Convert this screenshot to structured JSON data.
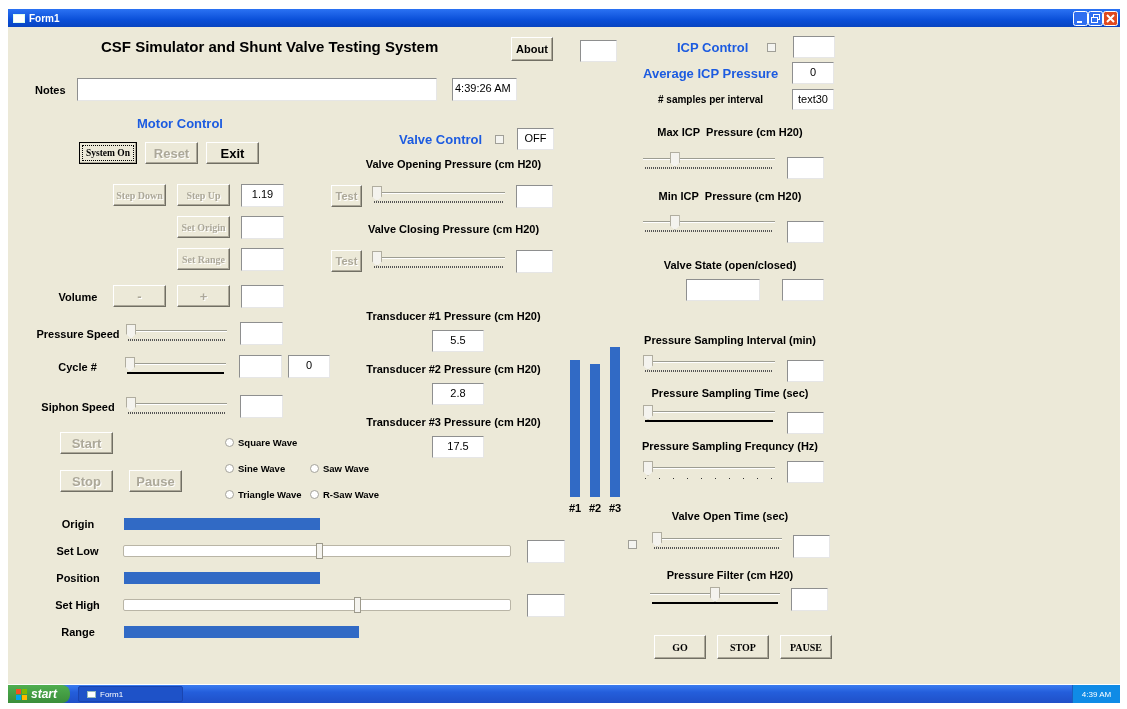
{
  "window": {
    "title": "Form1"
  },
  "header": {
    "title": "CSF Simulator and Shunt Valve Testing System",
    "about": {
      "label": "About",
      "disabled": false
    }
  },
  "notes": {
    "label": "Notes",
    "clock": "4:39:26 AM"
  },
  "motor_control": {
    "title": "Motor Control",
    "main_buttons": [
      {
        "label": "System On",
        "disabled": false,
        "focused": true
      },
      {
        "label": "Reset",
        "disabled": true,
        "focused": false
      },
      {
        "label": "Exit",
        "disabled": false,
        "focused": false
      }
    ],
    "step_rows": [
      {
        "buttons": [
          {
            "label": "Step Down",
            "disabled": true
          },
          {
            "label": "Step Up",
            "disabled": true
          }
        ],
        "value": "1.19"
      },
      {
        "buttons": [
          {
            "label": "Set Origin",
            "disabled": true
          }
        ]
      },
      {
        "buttons": [
          {
            "label": "Set Range",
            "disabled": true
          }
        ]
      }
    ],
    "volume": {
      "label": "Volume",
      "buttons": [
        {
          "label": "-",
          "disabled": true
        },
        {
          "label": "+",
          "disabled": true
        }
      ]
    },
    "sliders": [
      {
        "label": "Pressure Speed",
        "level": 0,
        "kind": "dotted"
      },
      {
        "label": "Cycle #",
        "level": 0,
        "kind": "solid",
        "count": "0"
      },
      {
        "label": "Siphon Speed",
        "level": 0,
        "kind": "dotted"
      }
    ],
    "start": {
      "label": "Start",
      "disabled": true
    },
    "stop": {
      "label": "Stop",
      "disabled": true
    },
    "pause": {
      "label": "Pause",
      "disabled": true
    },
    "waveforms": [
      {
        "label": "Square Wave",
        "selected": false
      },
      {
        "label": "Sine Wave",
        "selected": false
      },
      {
        "label": "Saw Wave",
        "selected": false
      },
      {
        "label": "Triangle Wave",
        "selected": false
      },
      {
        "label": "R-Saw Wave",
        "selected": false
      }
    ]
  },
  "position": [
    {
      "label": "Origin",
      "kind": "bar"
    },
    {
      "label": "Set Low",
      "kind": "slider",
      "level": 0.5
    },
    {
      "label": "Position",
      "kind": "bar"
    },
    {
      "label": "Set High",
      "kind": "slider",
      "level": 0.6
    },
    {
      "label": "Range",
      "kind": "bar"
    }
  ],
  "valve_control": {
    "title": "Valve Control",
    "checked": false,
    "status": "OFF",
    "pressures": [
      {
        "label": "Valve Opening Pressure (cm H20)",
        "test": {
          "label": "Test",
          "disabled": true
        },
        "level": 0,
        "kind": "dotted"
      },
      {
        "label": "Valve Closing Pressure (cm H20)",
        "test": {
          "label": "Test",
          "disabled": true
        },
        "level": 0,
        "kind": "dotted"
      }
    ],
    "transducers": [
      {
        "label": "Transducer #1 Pressure (cm H20)",
        "value": "5.5"
      },
      {
        "label": "Transducer #2 Pressure (cm H20)",
        "value": "2.8"
      },
      {
        "label": "Transducer #3 Pressure (cm H20)",
        "value": "17.5"
      }
    ]
  },
  "transducer_bars": [
    {
      "label": "#1"
    },
    {
      "label": "#2"
    },
    {
      "label": "#3"
    }
  ],
  "icp_control": {
    "title": "ICP Control",
    "checked": false,
    "average_label": "Average ICP Pressure",
    "average": "0",
    "samples_label": "# samples per interval",
    "samples": "text30",
    "limits": [
      {
        "label": "Max ICP  Pressure (cm H20)",
        "level": 0.22,
        "kind": "dotted"
      },
      {
        "label": "Min ICP  Pressure (cm H20)",
        "level": 0.22,
        "kind": "dotted"
      }
    ],
    "valve_state_label": "Valve State (open/closed)",
    "sampling": [
      {
        "label": "Pressure Sampling Interval (min)",
        "level": 0,
        "kind": "dotted"
      },
      {
        "label": "Pressure Sampling Time (sec)",
        "level": 0,
        "kind": "solid"
      },
      {
        "label": "Pressure Sampling Frequncy (Hz)",
        "level": 0,
        "kind": "sparse"
      }
    ],
    "valve_open_time": {
      "label": "Valve Open Time (sec)",
      "checked": false,
      "level": 0,
      "kind": "dotted"
    },
    "filter": {
      "label": "Pressure Filter (cm H20)",
      "level": 0.5,
      "kind": "solid"
    },
    "buttons": [
      {
        "label": "GO",
        "disabled": false
      },
      {
        "label": "STOP",
        "disabled": false
      },
      {
        "label": "PAUSE",
        "disabled": false
      }
    ]
  },
  "taskbar": {
    "start": "start",
    "task": "Form1",
    "clock": "4:39 AM"
  }
}
